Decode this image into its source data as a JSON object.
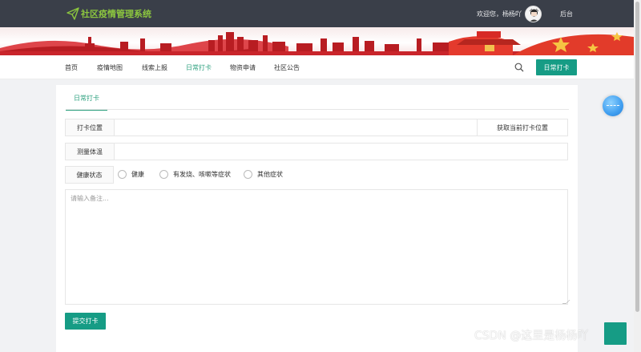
{
  "app": {
    "title": "社区疫情管理系统",
    "welcome": "欢迎您，杨杨吖",
    "backend_link": "后台"
  },
  "nav": {
    "items": [
      {
        "label": "首页"
      },
      {
        "label": "疫情地图"
      },
      {
        "label": "线索上报"
      },
      {
        "label": "日常打卡"
      },
      {
        "label": "物资申请"
      },
      {
        "label": "社区公告"
      }
    ],
    "active_index": 3,
    "action_button": "日常打卡"
  },
  "form": {
    "tab": "日常打卡",
    "location_label": "打卡位置",
    "location_value": "",
    "get_location_button": "获取当前打卡位置",
    "temperature_label": "测量体温",
    "temperature_value": "",
    "health_label": "健康状态",
    "health_options": [
      {
        "label": "健康"
      },
      {
        "label": "有发烧、咳嗽等症状"
      },
      {
        "label": "其他症状"
      }
    ],
    "remarks_placeholder": "请输入备注...",
    "submit_button": "提交打卡"
  },
  "watermark": "CSDN @这里是杨杨吖",
  "colors": {
    "topbar": "#3a3f49",
    "accent": "#169c85",
    "logo": "#8cc63f",
    "active_nav": "#2ea17f"
  }
}
